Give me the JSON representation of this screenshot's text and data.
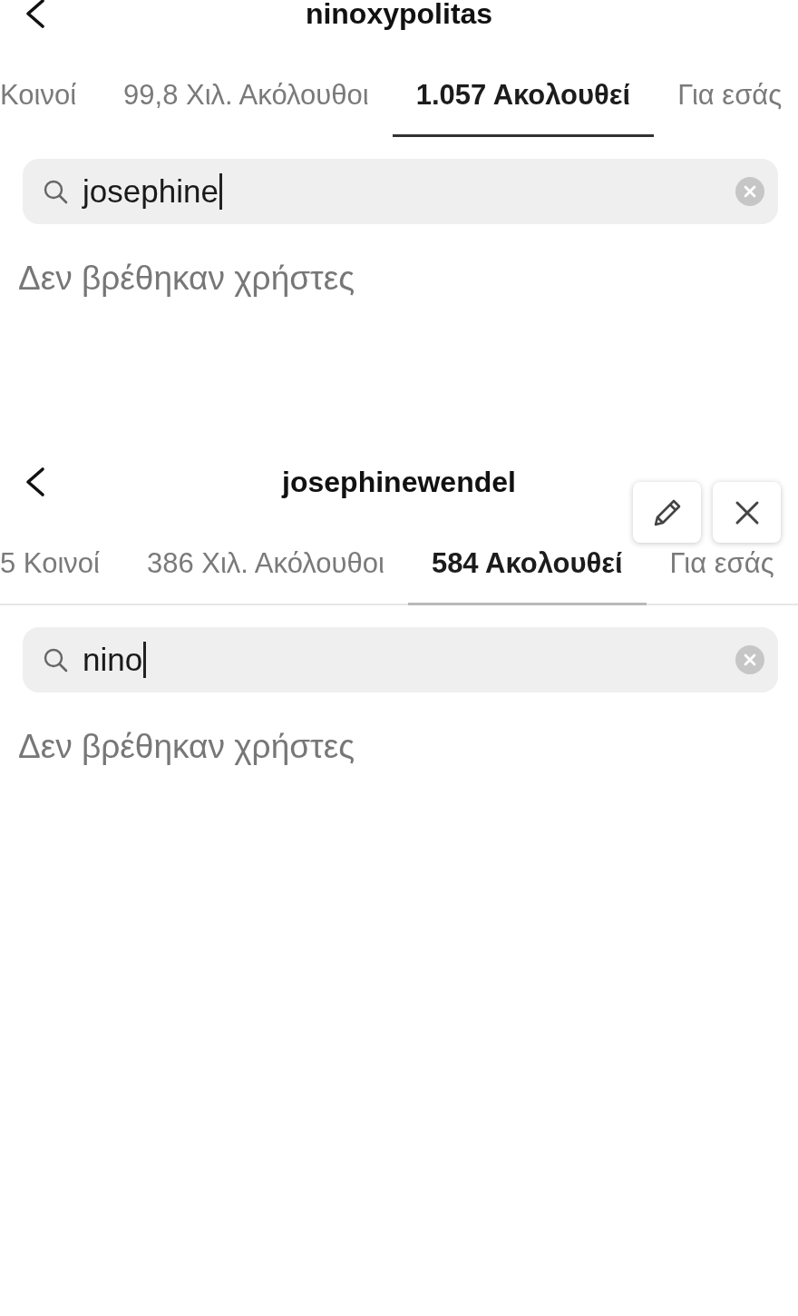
{
  "panels": [
    {
      "title": "ninoxypolitas",
      "tabs": [
        {
          "label": "Κοινοί",
          "selected": false
        },
        {
          "label": "99,8 Χιλ. Ακόλουθοι",
          "selected": false
        },
        {
          "label": "1.057 Ακολουθεί",
          "selected": true
        },
        {
          "label": "Για εσάς",
          "selected": false
        }
      ],
      "divider": false,
      "search": {
        "value": "josephine",
        "focused": true
      },
      "empty_message": "Δεν βρέθηκαν χρήστες"
    },
    {
      "title": "josephinewendel",
      "overlay_buttons": [
        {
          "kind": "edit"
        },
        {
          "kind": "close"
        }
      ],
      "tabs": [
        {
          "label": "5 Κοινοί",
          "selected": false
        },
        {
          "label": "386 Χιλ. Ακόλουθοι",
          "selected": false
        },
        {
          "label": "584 Ακολουθεί",
          "selected": true
        },
        {
          "label": "Για εσάς",
          "selected": false
        }
      ],
      "divider": true,
      "search": {
        "value": "nino",
        "focused": true
      },
      "empty_message": "Δεν βρέθηκαν χρήστες"
    }
  ]
}
